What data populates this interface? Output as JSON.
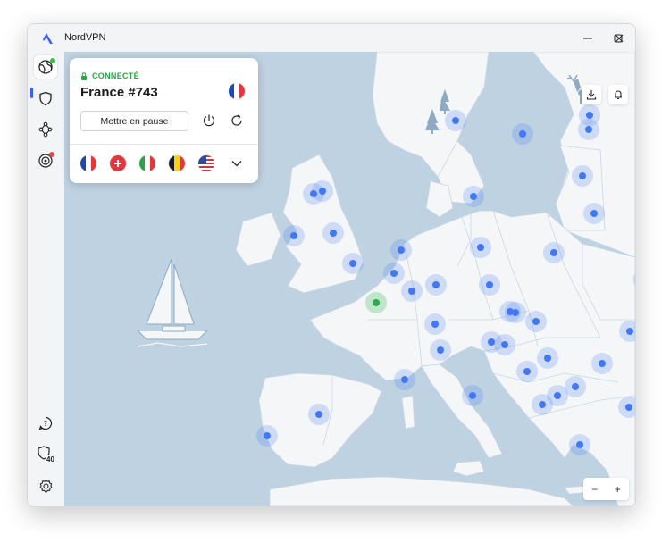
{
  "window": {
    "title": "NordVPN",
    "controls": [
      "minimize",
      "maximize",
      "close"
    ]
  },
  "sidebar": {
    "items": [
      {
        "name": "globe-icon",
        "active": true,
        "badge": "green"
      },
      {
        "name": "shield-icon",
        "active": false
      },
      {
        "name": "meshnet-icon",
        "active": false
      },
      {
        "name": "threat-protection-icon",
        "active": false,
        "badge": "red"
      }
    ],
    "bottom": [
      {
        "name": "help-icon"
      },
      {
        "name": "dark-web-monitor-icon",
        "label": "40"
      },
      {
        "name": "settings-icon"
      }
    ]
  },
  "connection": {
    "status": "CONNECTÉ",
    "server": "France #743",
    "pause_label": "Mettre en pause",
    "recent_flags": [
      "france",
      "switzerland",
      "italy",
      "belgium",
      "usa"
    ]
  },
  "map": {
    "colors": {
      "sea": "#bfd2e1",
      "land": "#f5f6f8",
      "server": "#4278f5",
      "connected": "#2fa84f"
    },
    "servers": [
      {
        "country": "Norway"
      },
      {
        "country": "Sweden"
      },
      {
        "country": "Finland"
      },
      {
        "country": "Estonia"
      },
      {
        "country": "Latvia"
      },
      {
        "country": "Lithuania"
      },
      {
        "country": "Denmark"
      },
      {
        "country": "Scotland"
      },
      {
        "country": "Isle of Man"
      },
      {
        "country": "Ireland"
      },
      {
        "country": "UK North"
      },
      {
        "country": "UK London"
      },
      {
        "country": "Netherlands"
      },
      {
        "country": "Belgium"
      },
      {
        "country": "Luxembourg"
      },
      {
        "country": "France",
        "connected": true
      },
      {
        "country": "Germany"
      },
      {
        "country": "Poland"
      },
      {
        "country": "Czech Republic"
      },
      {
        "country": "Ukraine"
      },
      {
        "country": "Slovakia"
      },
      {
        "country": "Austria"
      },
      {
        "country": "Hungary"
      },
      {
        "country": "Switzerland"
      },
      {
        "country": "Italy North"
      },
      {
        "country": "Slovenia"
      },
      {
        "country": "Croatia"
      },
      {
        "country": "Moldova"
      },
      {
        "country": "Romania"
      },
      {
        "country": "Serbia"
      },
      {
        "country": "Bosnia"
      },
      {
        "country": "Bulgaria"
      },
      {
        "country": "Montenegro"
      },
      {
        "country": "North Macedonia"
      },
      {
        "country": "Albania"
      },
      {
        "country": "Greece"
      },
      {
        "country": "Turkey"
      },
      {
        "country": "Monaco"
      },
      {
        "country": "Spain"
      },
      {
        "country": "Portugal"
      },
      {
        "country": "Italy South"
      },
      {
        "country": "Albania South"
      }
    ]
  },
  "zoom": {
    "minus": "−",
    "plus": "+"
  }
}
